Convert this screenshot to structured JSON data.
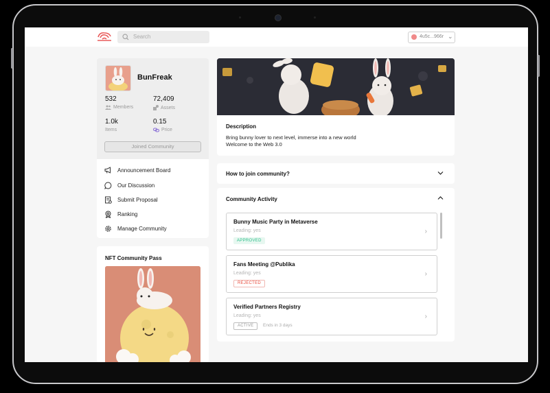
{
  "header": {
    "search_placeholder": "Search",
    "wallet_address": "4u5c...966r"
  },
  "profile": {
    "name": "BunFreak",
    "stats": [
      {
        "value": "532",
        "label": "Members",
        "icon": "members-icon"
      },
      {
        "value": "72,409",
        "label": "Assets",
        "icon": "assets-icon"
      },
      {
        "value": "1.0k",
        "label": "Items",
        "icon": ""
      },
      {
        "value": "0.15",
        "label": "Price",
        "icon": "link-icon"
      }
    ],
    "joined_label": "Joined Community"
  },
  "menu": {
    "items": [
      {
        "label": "Announcement Board",
        "icon": "megaphone-icon"
      },
      {
        "label": "Our Discussion",
        "icon": "chat-bubble-icon"
      },
      {
        "label": "Submit Proposal",
        "icon": "document-icon"
      },
      {
        "label": "Ranking",
        "icon": "award-icon"
      },
      {
        "label": "Manage Community",
        "icon": "gear-icon"
      }
    ]
  },
  "nft": {
    "title": "NFT Community Pass"
  },
  "description": {
    "heading": "Description",
    "line1": "Bring bunny lover to next level, immerse into a new world",
    "line2": "Welcome to the Web 3.0"
  },
  "howto": {
    "heading": "How to join community?"
  },
  "activity": {
    "heading": "Community Activity",
    "items": [
      {
        "title": "Bunny Music Party in Metaverse",
        "subtitle": "Leading: yes",
        "badge": "APPROVED",
        "extra": ""
      },
      {
        "title": "Fans Meeting @Publika",
        "subtitle": "Leading: yes",
        "badge": "REJECTED",
        "extra": ""
      },
      {
        "title": "Verified Partners Registry",
        "subtitle": "Leading: yes",
        "badge": "ACTIVE",
        "extra": "Ends in 3 days"
      }
    ]
  },
  "colors": {
    "approved": "#2bbf8a",
    "rejected": "#e84b3c",
    "active": "#9a9a9a",
    "brand": "#e95a5a"
  }
}
